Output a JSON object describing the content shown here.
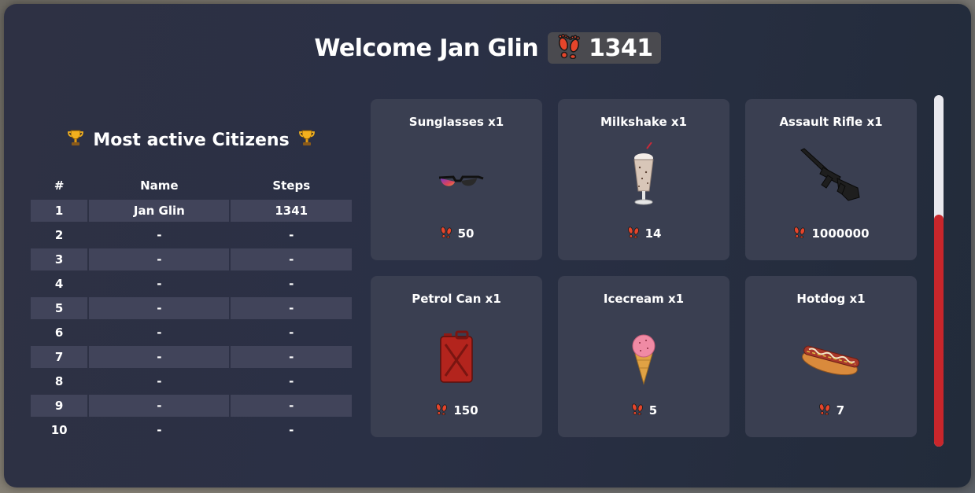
{
  "welcome": {
    "title": "Welcome Jan Glin",
    "steps": "1341",
    "steps_icon": "footprints-icon"
  },
  "leaderboard": {
    "title": "Most active Citizens",
    "trophy_icon": "trophy-icon",
    "columns": [
      "#",
      "Name",
      "Steps"
    ],
    "rows": [
      {
        "rank": "1",
        "name": "Jan Glin",
        "steps": "1341"
      },
      {
        "rank": "2",
        "name": "-",
        "steps": "-"
      },
      {
        "rank": "3",
        "name": "-",
        "steps": "-"
      },
      {
        "rank": "4",
        "name": "-",
        "steps": "-"
      },
      {
        "rank": "5",
        "name": "-",
        "steps": "-"
      },
      {
        "rank": "6",
        "name": "-",
        "steps": "-"
      },
      {
        "rank": "7",
        "name": "-",
        "steps": "-"
      },
      {
        "rank": "8",
        "name": "-",
        "steps": "-"
      },
      {
        "rank": "9",
        "name": "-",
        "steps": "-"
      },
      {
        "rank": "10",
        "name": "-",
        "steps": "-"
      }
    ]
  },
  "shop": {
    "items": [
      {
        "title": "Sunglasses x1",
        "price": "50",
        "icon": "sunglasses-icon"
      },
      {
        "title": "Milkshake x1",
        "price": "14",
        "icon": "milkshake-icon"
      },
      {
        "title": "Assault Rifle x1",
        "price": "1000000",
        "icon": "assault-rifle-icon"
      },
      {
        "title": "Petrol Can x1",
        "price": "150",
        "icon": "petrol-can-icon"
      },
      {
        "title": "Icecream x1",
        "price": "5",
        "icon": "icecream-icon"
      },
      {
        "title": "Hotdog x1",
        "price": "7",
        "icon": "hotdog-icon"
      }
    ]
  },
  "scroll": {
    "position_fraction": 0.34
  },
  "colors": {
    "panel_bg": "#2a3045",
    "card_bg": "#3a3f51",
    "accent_red": "#c9262b",
    "footprint_orange": "#e5452b"
  }
}
